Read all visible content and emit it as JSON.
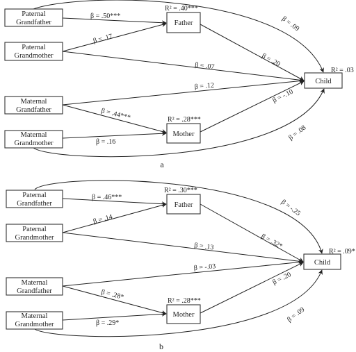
{
  "panels": [
    {
      "label": "a",
      "nodes": {
        "pgf": [
          "Paternal",
          "Grandfather"
        ],
        "pgm": [
          "Paternal",
          "Grandmother"
        ],
        "mgf": [
          "Maternal",
          "Grandfather"
        ],
        "mgm": [
          "Maternal",
          "Grandmother"
        ],
        "father": "Father",
        "mother": "Mother",
        "child": "Child"
      },
      "r2": {
        "father": "R² = .40***",
        "mother": "R² = .28***",
        "child": "R² = .03"
      },
      "paths": {
        "pgf_father": "β = .50***",
        "pgm_father": "β = .17",
        "pgm_child": "β = .07",
        "pgf_child": "β = .09",
        "father_child": "β = .20",
        "mgf_child": "β = .12",
        "mgf_mother": "β = .44***",
        "mgm_mother": "β = .16",
        "mother_child": "β = -.10",
        "mgm_child": "β = .08"
      }
    },
    {
      "label": "b",
      "nodes": {
        "pgf": [
          "Paternal",
          "Grandfather"
        ],
        "pgm": [
          "Paternal",
          "Grandmother"
        ],
        "mgf": [
          "Maternal",
          "Grandfather"
        ],
        "mgm": [
          "Maternal",
          "Grandmother"
        ],
        "father": "Father",
        "mother": "Mother",
        "child": "Child"
      },
      "r2": {
        "father": "R² = .30***",
        "mother": "R² = .28***",
        "child": "R² = .09*"
      },
      "paths": {
        "pgf_father": "β = .46***",
        "pgm_father": "β = .14",
        "pgm_child": "β = .13",
        "pgf_child": "β = -.25",
        "father_child": "β = .32*",
        "mgf_child": "β = -.03",
        "mgf_mother": "β = .28*",
        "mgm_mother": "β = .29*",
        "mother_child": "β = .20",
        "mgm_child": "β = .09"
      }
    }
  ]
}
